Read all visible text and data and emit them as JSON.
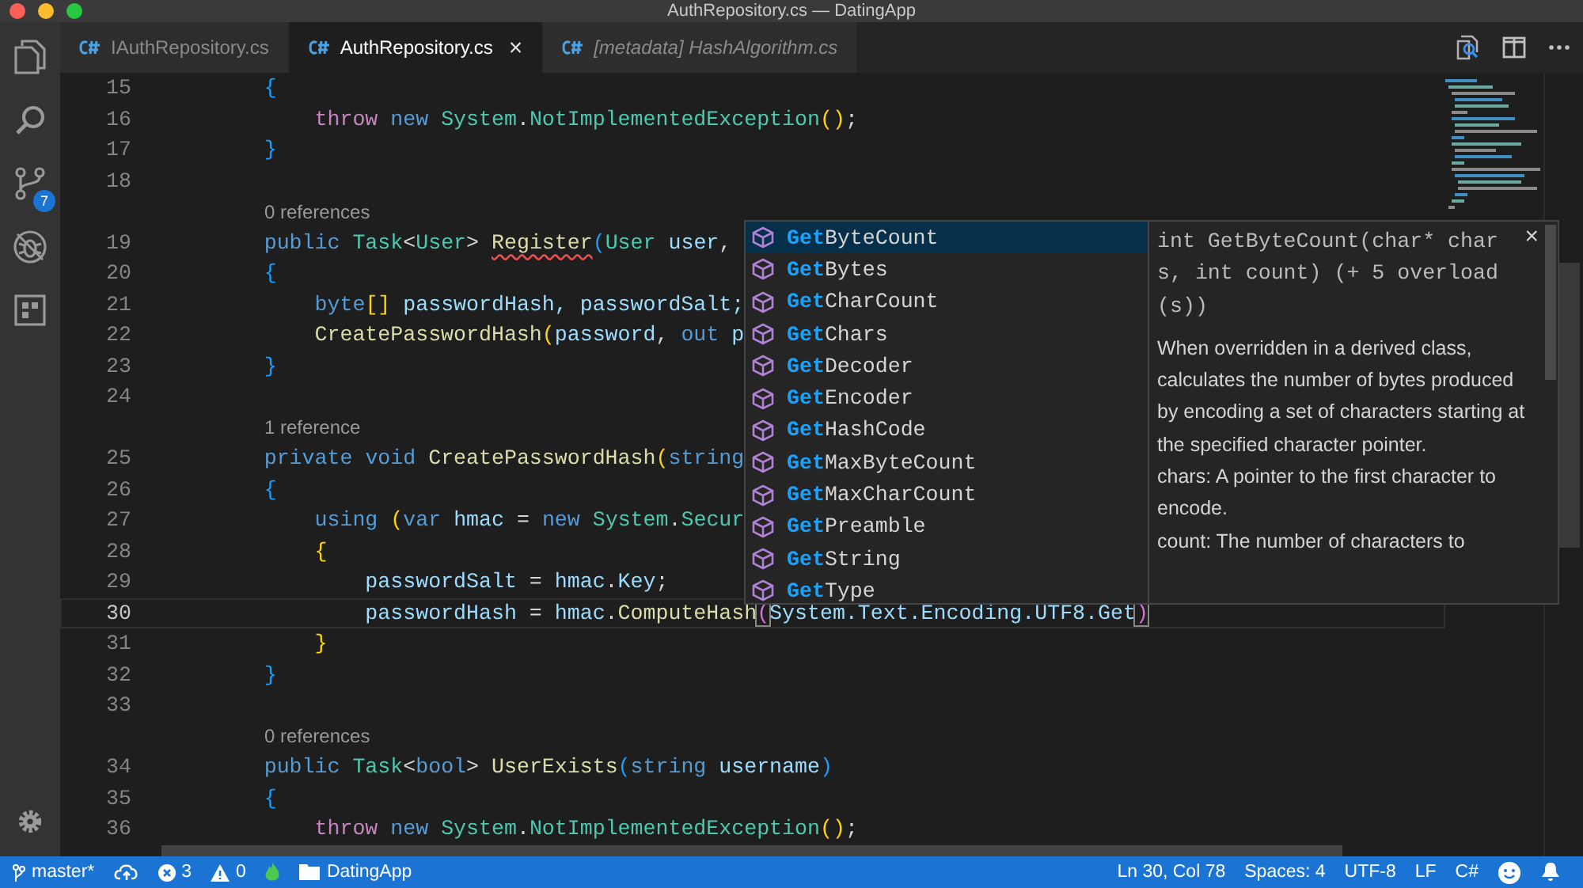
{
  "window": {
    "title": "AuthRepository.cs — DatingApp"
  },
  "activity_bar": {
    "items": [
      {
        "kind": "files"
      },
      {
        "kind": "search"
      },
      {
        "kind": "scm",
        "badge": "7"
      },
      {
        "kind": "debug"
      },
      {
        "kind": "extensions"
      }
    ],
    "bottom": [
      {
        "kind": "settings"
      }
    ]
  },
  "tabs": [
    {
      "label": "IAuthRepository.cs",
      "selected": false,
      "preview": false
    },
    {
      "label": "AuthRepository.cs",
      "selected": true,
      "preview": false,
      "close": "×"
    },
    {
      "label": "[metadata] HashAlgorithm.cs",
      "selected": false,
      "preview": true
    }
  ],
  "tab_actions": [
    {
      "kind": "open-changes"
    },
    {
      "kind": "split"
    },
    {
      "kind": "more"
    }
  ],
  "editor": {
    "lines": [
      {
        "kind": "code",
        "number": "15",
        "current": false,
        "tokens": [
          {
            "kind": "b3",
            "t": "        {"
          }
        ]
      },
      {
        "kind": "code",
        "number": "16",
        "current": false,
        "tokens": [
          {
            "kind": "ctrl",
            "t": "            throw "
          },
          {
            "kind": "kw",
            "t": "new "
          },
          {
            "kind": "type",
            "t": "System"
          },
          {
            "kind": "punct",
            "t": "."
          },
          {
            "kind": "type",
            "t": "NotImplementedException"
          },
          {
            "kind": "b1",
            "t": "()"
          },
          {
            "kind": "punct",
            "t": ";"
          }
        ]
      },
      {
        "kind": "code",
        "number": "17",
        "current": false,
        "tokens": [
          {
            "kind": "b3",
            "t": "        }"
          }
        ]
      },
      {
        "kind": "code",
        "number": "18",
        "current": false
      },
      {
        "kind": "lens",
        "text": "0 references"
      },
      {
        "kind": "code",
        "number": "19",
        "current": false,
        "tokens": [
          {
            "kind": "kw",
            "t": "        public "
          },
          {
            "kind": "type",
            "t": "Task"
          },
          {
            "kind": "punct",
            "t": "<"
          },
          {
            "kind": "type",
            "t": "User"
          },
          {
            "kind": "punct",
            "t": "> "
          },
          {
            "kind": "err-fn",
            "t": "Register"
          },
          {
            "kind": "b3",
            "t": "("
          },
          {
            "kind": "type",
            "t": "User "
          },
          {
            "kind": "var",
            "t": "user"
          },
          {
            "kind": "punct",
            "t": ","
          }
        ]
      },
      {
        "kind": "code",
        "number": "20",
        "current": false,
        "tokens": [
          {
            "kind": "b3",
            "t": "        {"
          }
        ]
      },
      {
        "kind": "code",
        "number": "21",
        "current": false,
        "tokens": [
          {
            "kind": "kw",
            "t": "            byte"
          },
          {
            "kind": "b1",
            "t": "[]"
          },
          {
            "kind": "var",
            "t": " passwordHash, passwordSalt;"
          }
        ]
      },
      {
        "kind": "code",
        "number": "22",
        "current": false,
        "tokens": [
          {
            "kind": "fn",
            "t": "            CreatePasswordHash"
          },
          {
            "kind": "b1",
            "t": "("
          },
          {
            "kind": "var",
            "t": "password"
          },
          {
            "kind": "punct",
            "t": ", "
          },
          {
            "kind": "kw",
            "t": "out "
          },
          {
            "kind": "var",
            "t": "p"
          }
        ]
      },
      {
        "kind": "code",
        "number": "23",
        "current": false,
        "tokens": [
          {
            "kind": "b3",
            "t": "        }"
          }
        ]
      },
      {
        "kind": "code",
        "number": "24",
        "current": false
      },
      {
        "kind": "lens",
        "text": "1 reference"
      },
      {
        "kind": "code",
        "number": "25",
        "current": false,
        "tokens": [
          {
            "kind": "kw",
            "t": "        private "
          },
          {
            "kind": "kw",
            "t": "void "
          },
          {
            "kind": "fn",
            "t": "CreatePasswordHash"
          },
          {
            "kind": "b1",
            "t": "("
          },
          {
            "kind": "kw",
            "t": "string"
          }
        ]
      },
      {
        "kind": "code",
        "number": "26",
        "current": false,
        "tokens": [
          {
            "kind": "b3",
            "t": "        {"
          }
        ]
      },
      {
        "kind": "code",
        "number": "27",
        "current": false,
        "tokens": [
          {
            "kind": "kw",
            "t": "            using "
          },
          {
            "kind": "b1",
            "t": "("
          },
          {
            "kind": "kw",
            "t": "var "
          },
          {
            "kind": "var",
            "t": "hmac "
          },
          {
            "kind": "punct",
            "t": "= "
          },
          {
            "kind": "kw",
            "t": "new "
          },
          {
            "kind": "type",
            "t": "System"
          },
          {
            "kind": "punct",
            "t": "."
          },
          {
            "kind": "type",
            "t": "Secur"
          }
        ]
      },
      {
        "kind": "code",
        "number": "28",
        "current": false,
        "tokens": [
          {
            "kind": "b1",
            "t": "            {"
          }
        ]
      },
      {
        "kind": "code",
        "number": "29",
        "current": false,
        "tokens": [
          {
            "kind": "var",
            "t": "                passwordSalt "
          },
          {
            "kind": "punct",
            "t": "= "
          },
          {
            "kind": "var",
            "t": "hmac"
          },
          {
            "kind": "punct",
            "t": "."
          },
          {
            "kind": "var",
            "t": "Key"
          },
          {
            "kind": "punct",
            "t": ";"
          }
        ]
      },
      {
        "kind": "code",
        "number": "30",
        "current": true,
        "tokens": [
          {
            "kind": "var",
            "t": "                passwordHash "
          },
          {
            "kind": "punct",
            "t": "= "
          },
          {
            "kind": "var",
            "t": "hmac"
          },
          {
            "kind": "punct",
            "t": "."
          },
          {
            "kind": "fn",
            "t": "ComputeHash"
          },
          {
            "kind": "match",
            "t": "("
          },
          {
            "kind": "var",
            "t": "System.Text.Encoding.UTF8.Get"
          },
          {
            "kind": "match",
            "t": ")"
          }
        ]
      },
      {
        "kind": "code",
        "number": "31",
        "current": false,
        "tokens": [
          {
            "kind": "b1",
            "t": "            }"
          }
        ]
      },
      {
        "kind": "code",
        "number": "32",
        "current": false,
        "tokens": [
          {
            "kind": "b3",
            "t": "        }"
          }
        ]
      },
      {
        "kind": "code",
        "number": "33",
        "current": false
      },
      {
        "kind": "lens",
        "text": "0 references"
      },
      {
        "kind": "code",
        "number": "34",
        "current": false,
        "tokens": [
          {
            "kind": "kw",
            "t": "        public "
          },
          {
            "kind": "type",
            "t": "Task"
          },
          {
            "kind": "punct",
            "t": "<"
          },
          {
            "kind": "kw",
            "t": "bool"
          },
          {
            "kind": "punct",
            "t": "> "
          },
          {
            "kind": "fn",
            "t": "UserExists"
          },
          {
            "kind": "b3",
            "t": "("
          },
          {
            "kind": "kw",
            "t": "string "
          },
          {
            "kind": "var",
            "t": "username"
          },
          {
            "kind": "b3",
            "t": ")"
          }
        ]
      },
      {
        "kind": "code",
        "number": "35",
        "current": false,
        "tokens": [
          {
            "kind": "b3",
            "t": "        {"
          }
        ]
      },
      {
        "kind": "code",
        "number": "36",
        "current": false,
        "tokens": [
          {
            "kind": "ctrl",
            "t": "            throw "
          },
          {
            "kind": "kw",
            "t": "new "
          },
          {
            "kind": "type",
            "t": "System"
          },
          {
            "kind": "punct",
            "t": "."
          },
          {
            "kind": "type",
            "t": "NotImplementedException"
          },
          {
            "kind": "b1",
            "t": "()"
          },
          {
            "kind": "punct",
            "t": ";"
          }
        ]
      }
    ]
  },
  "suggest": {
    "items": [
      {
        "match": "Get",
        "rest": "ByteCount",
        "selected": true
      },
      {
        "match": "Get",
        "rest": "Bytes",
        "selected": false
      },
      {
        "match": "Get",
        "rest": "CharCount",
        "selected": false
      },
      {
        "match": "Get",
        "rest": "Chars",
        "selected": false
      },
      {
        "match": "Get",
        "rest": "Decoder",
        "selected": false
      },
      {
        "match": "Get",
        "rest": "Encoder",
        "selected": false
      },
      {
        "match": "Get",
        "rest": "HashCode",
        "selected": false
      },
      {
        "match": "Get",
        "rest": "MaxByteCount",
        "selected": false
      },
      {
        "match": "Get",
        "rest": "MaxCharCount",
        "selected": false
      },
      {
        "match": "Get",
        "rest": "Preamble",
        "selected": false
      },
      {
        "match": "Get",
        "rest": "String",
        "selected": false
      },
      {
        "match": "Get",
        "rest": "Type",
        "selected": false
      }
    ],
    "details": {
      "signature": "int GetByteCount(char* chars, int count) (+ 5 overload(s))",
      "close": "×",
      "doc": [
        "When overridden in a derived class, calculates the number of bytes produced by encoding a set of characters starting at the specified character pointer.",
        "chars: A pointer to the first character to encode.",
        "count: The number of characters to"
      ]
    }
  },
  "status_bar": {
    "left": [
      {
        "kind": "branch",
        "text": "master*"
      },
      {
        "kind": "sync"
      },
      {
        "kind": "errors",
        "text": "3"
      },
      {
        "kind": "warnings",
        "text": "0"
      },
      {
        "kind": "flame"
      },
      {
        "kind": "folder",
        "text": "DatingApp"
      }
    ],
    "right": [
      {
        "kind": "text",
        "text": "Ln 30, Col 78"
      },
      {
        "kind": "text",
        "text": "Spaces: 4"
      },
      {
        "kind": "text",
        "text": "UTF-8"
      },
      {
        "kind": "text",
        "text": "LF"
      },
      {
        "kind": "text",
        "text": "C#"
      },
      {
        "kind": "feedback"
      },
      {
        "kind": "bell"
      }
    ]
  }
}
